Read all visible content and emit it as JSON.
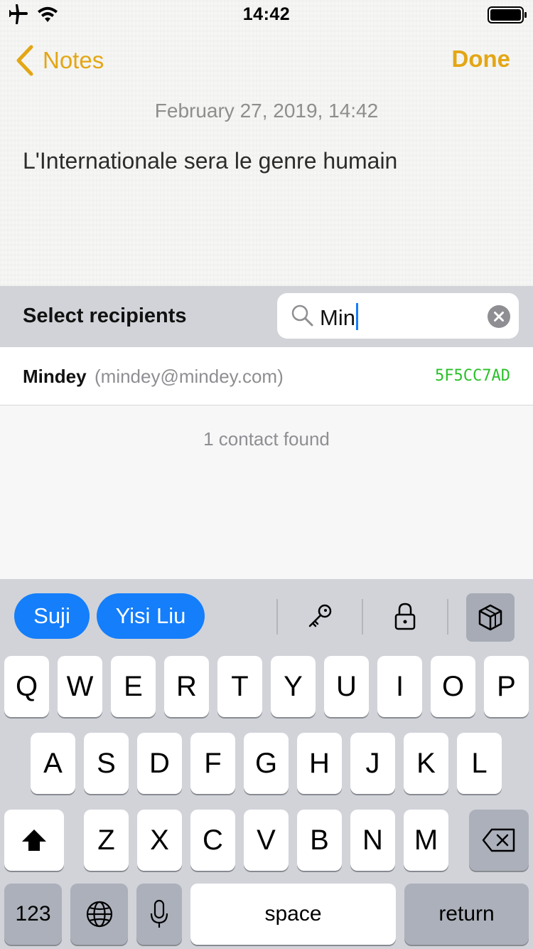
{
  "status_bar": {
    "time": "14:42",
    "icons": [
      "airplane-icon",
      "wifi-icon",
      "battery-icon"
    ]
  },
  "nav": {
    "back_label": "Notes",
    "done_label": "Done"
  },
  "note": {
    "date": "February 27, 2019, 14:42",
    "body": "L'Internationale sera le genre humain"
  },
  "recipients": {
    "title": "Select recipients",
    "search_value": "Min",
    "results": [
      {
        "name": "Mindey",
        "email": "(mindey@mindey.com)",
        "key_id": "5F5CC7AD"
      }
    ],
    "count_text": "1 contact found"
  },
  "keyboard": {
    "chips": [
      "Suji",
      "Yisi Liu"
    ],
    "toolbar_icons": [
      "key-icon",
      "lock-icon",
      "cube-icon"
    ],
    "row1": [
      "Q",
      "W",
      "E",
      "R",
      "T",
      "Y",
      "U",
      "I",
      "O",
      "P"
    ],
    "row2": [
      "A",
      "S",
      "D",
      "F",
      "G",
      "H",
      "J",
      "K",
      "L"
    ],
    "row3": [
      "Z",
      "X",
      "C",
      "V",
      "B",
      "N",
      "M"
    ],
    "numbers_label": "123",
    "space_label": "space",
    "return_label": "return"
  },
  "colors": {
    "accent": "#e3a614",
    "ios_blue": "#147efb",
    "key_id_green": "#2ac12a"
  }
}
